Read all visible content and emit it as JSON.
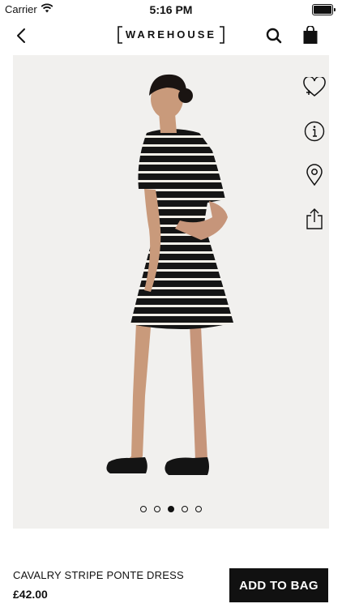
{
  "status_bar": {
    "carrier": "Carrier",
    "time": "5:16 PM",
    "battery_level": 1.0
  },
  "header": {
    "brand": "WAREHOUSE",
    "icons": [
      "back-icon",
      "search-icon",
      "bag-icon"
    ]
  },
  "gallery": {
    "side_actions": [
      "heart-plus-icon",
      "info-icon",
      "location-pin-icon",
      "share-icon"
    ],
    "page_count": 5,
    "active_page": 3
  },
  "product": {
    "name": "CAVALRY STRIPE PONTE DRESS",
    "price": "£42.00",
    "add_to_bag_label": "ADD TO BAG"
  },
  "colors": {
    "accent": "#111111",
    "image_background": "#f1f0ee"
  }
}
